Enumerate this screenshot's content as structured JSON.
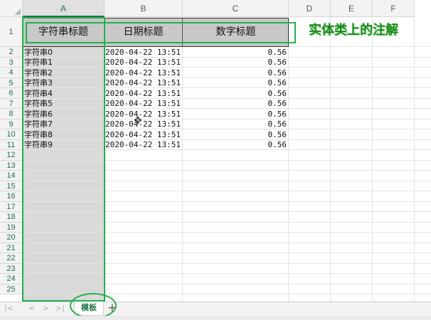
{
  "columns": [
    "A",
    "B",
    "C",
    "D",
    "E",
    "F"
  ],
  "rows": [
    "1",
    "2",
    "3",
    "4",
    "5",
    "6",
    "7",
    "8",
    "9",
    "10",
    "11",
    "12",
    "13",
    "14",
    "15",
    "16",
    "17",
    "18",
    "19",
    "20",
    "21",
    "22",
    "23",
    "24",
    "25"
  ],
  "headers": {
    "string_title": "字符串标题",
    "date_title": "日期标题",
    "number_title": "数字标题"
  },
  "data_rows": [
    {
      "str": "字符串0",
      "date": "2020-04-22 13:51:",
      "num": "0.56"
    },
    {
      "str": "字符串1",
      "date": "2020-04-22 13:51:",
      "num": "0.56"
    },
    {
      "str": "字符串2",
      "date": "2020-04-22 13:51:",
      "num": "0.56"
    },
    {
      "str": "字符串3",
      "date": "2020-04-22 13:51:",
      "num": "0.56"
    },
    {
      "str": "字符串4",
      "date": "2020-04-22 13:51:",
      "num": "0.56"
    },
    {
      "str": "字符串5",
      "date": "2020-04-22 13:51:",
      "num": "0.56"
    },
    {
      "str": "字符串6",
      "date": "2020-04-22 13:51:",
      "num": "0.56"
    },
    {
      "str": "字符串7",
      "date": "2020-04-22 13:51:",
      "num": "0.56"
    },
    {
      "str": "字符串8",
      "date": "2020-04-22 13:51:",
      "num": "0.56"
    },
    {
      "str": "字符串9",
      "date": "2020-04-22 13:51:",
      "num": "0.56"
    }
  ],
  "annotation": "实体类上的注解",
  "sheet_tab": "模板",
  "add_sheet": "+",
  "nav_icons": [
    "first-sheet-icon",
    "prev-sheet-icon",
    "next-sheet-icon",
    "last-sheet-icon"
  ],
  "colors": {
    "accent": "#217346",
    "annotation": "#22b14c",
    "header_fill": "#c8c8c8",
    "column_fill": "#d9d9d9"
  }
}
